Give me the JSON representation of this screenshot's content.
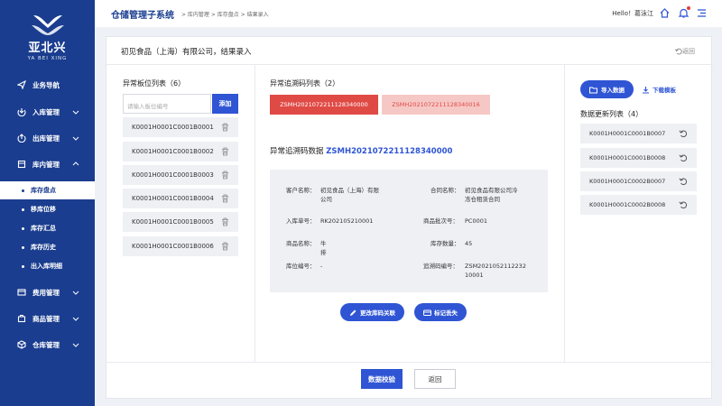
{
  "app": {
    "logo_text": "亚北兴",
    "logo_sub": "YA BEI XING",
    "title": "仓储管理子系统"
  },
  "breadcrumb": [
    "库内管理",
    "库存盘点",
    "结果录入"
  ],
  "breadcrumb_text": "> 库内管理 > 库存盘点 > 结果录入",
  "user": {
    "greeting": "Hello！葛泳江"
  },
  "sidebar": {
    "items": [
      {
        "label": "业务导航",
        "icon": "navigation-icon"
      },
      {
        "label": "入库管理",
        "icon": "inbound-icon"
      },
      {
        "label": "出库管理",
        "icon": "outbound-icon"
      },
      {
        "label": "库内管理",
        "icon": "warehouse-icon"
      },
      {
        "label": "费用管理",
        "icon": "fee-icon"
      },
      {
        "label": "商品管理",
        "icon": "goods-icon"
      },
      {
        "label": "仓库管理",
        "icon": "storage-icon"
      }
    ],
    "subitems": [
      "库存盘点",
      "移库位移",
      "库存汇总",
      "库存历史",
      "出入库明细"
    ]
  },
  "page": {
    "title": "初见食品（上海）有限公司，结果录入",
    "back_label": "返回"
  },
  "locations": {
    "title": "异常板位列表（6）",
    "input_placeholder": "请输入板位编号",
    "add_label": "添加",
    "items": [
      "K0001H0001C0001B0001",
      "K0001H0001C0001B0002",
      "K0001H0001C0001B0003",
      "K0001H0001C0001B0004",
      "K0001H0001C0001B0005",
      "K0001H0001C0001B0006"
    ]
  },
  "trace": {
    "title": "异常追溯码列表（2）",
    "codes": [
      "ZSMH2021072211128340000",
      "ZSMH2021072211128340016"
    ],
    "detail_label": "异常追溯码数据",
    "detail_code": "ZSMH2021072211128340000",
    "fields": {
      "customer_k": "客户名称：",
      "customer_v1": "初见食品（上海）有限",
      "customer_v2": "公司",
      "contract_k": "合同名称：",
      "contract_v1": "初见食品有限公司冷",
      "contract_v2": "冻仓租赁合同",
      "inbound_k": "入库单号：",
      "inbound_v": "RK202105210001",
      "batch_k": "商品批次号：",
      "batch_v": "PC0001",
      "goods_k": "商品名称：",
      "goods_v": "牛排",
      "qty_k": "库存数量：",
      "qty_v": "45",
      "loc_k": "库位编号：",
      "loc_v": "-",
      "trace_k": "追溯码编号：",
      "trace_v1": "ZSM2021052112232",
      "trace_v2": "10001"
    },
    "change_label": "更改库码关联",
    "lost_label": "标记丢失"
  },
  "updates": {
    "import_label": "导入数据",
    "download_label": "下载模板",
    "title": "数据更新列表（4）",
    "items": [
      "K0001H0001C0001B0007",
      "K0001H0001C0001B0008",
      "K0001H0001C0002B0007",
      "K0001H0001C0002B0008"
    ]
  },
  "footer": {
    "verify_label": "数据校验",
    "back_label": "返回"
  },
  "colors": {
    "primary": "#2f55d4",
    "sidebar": "#1a3d8f",
    "danger": "#e04a45"
  }
}
